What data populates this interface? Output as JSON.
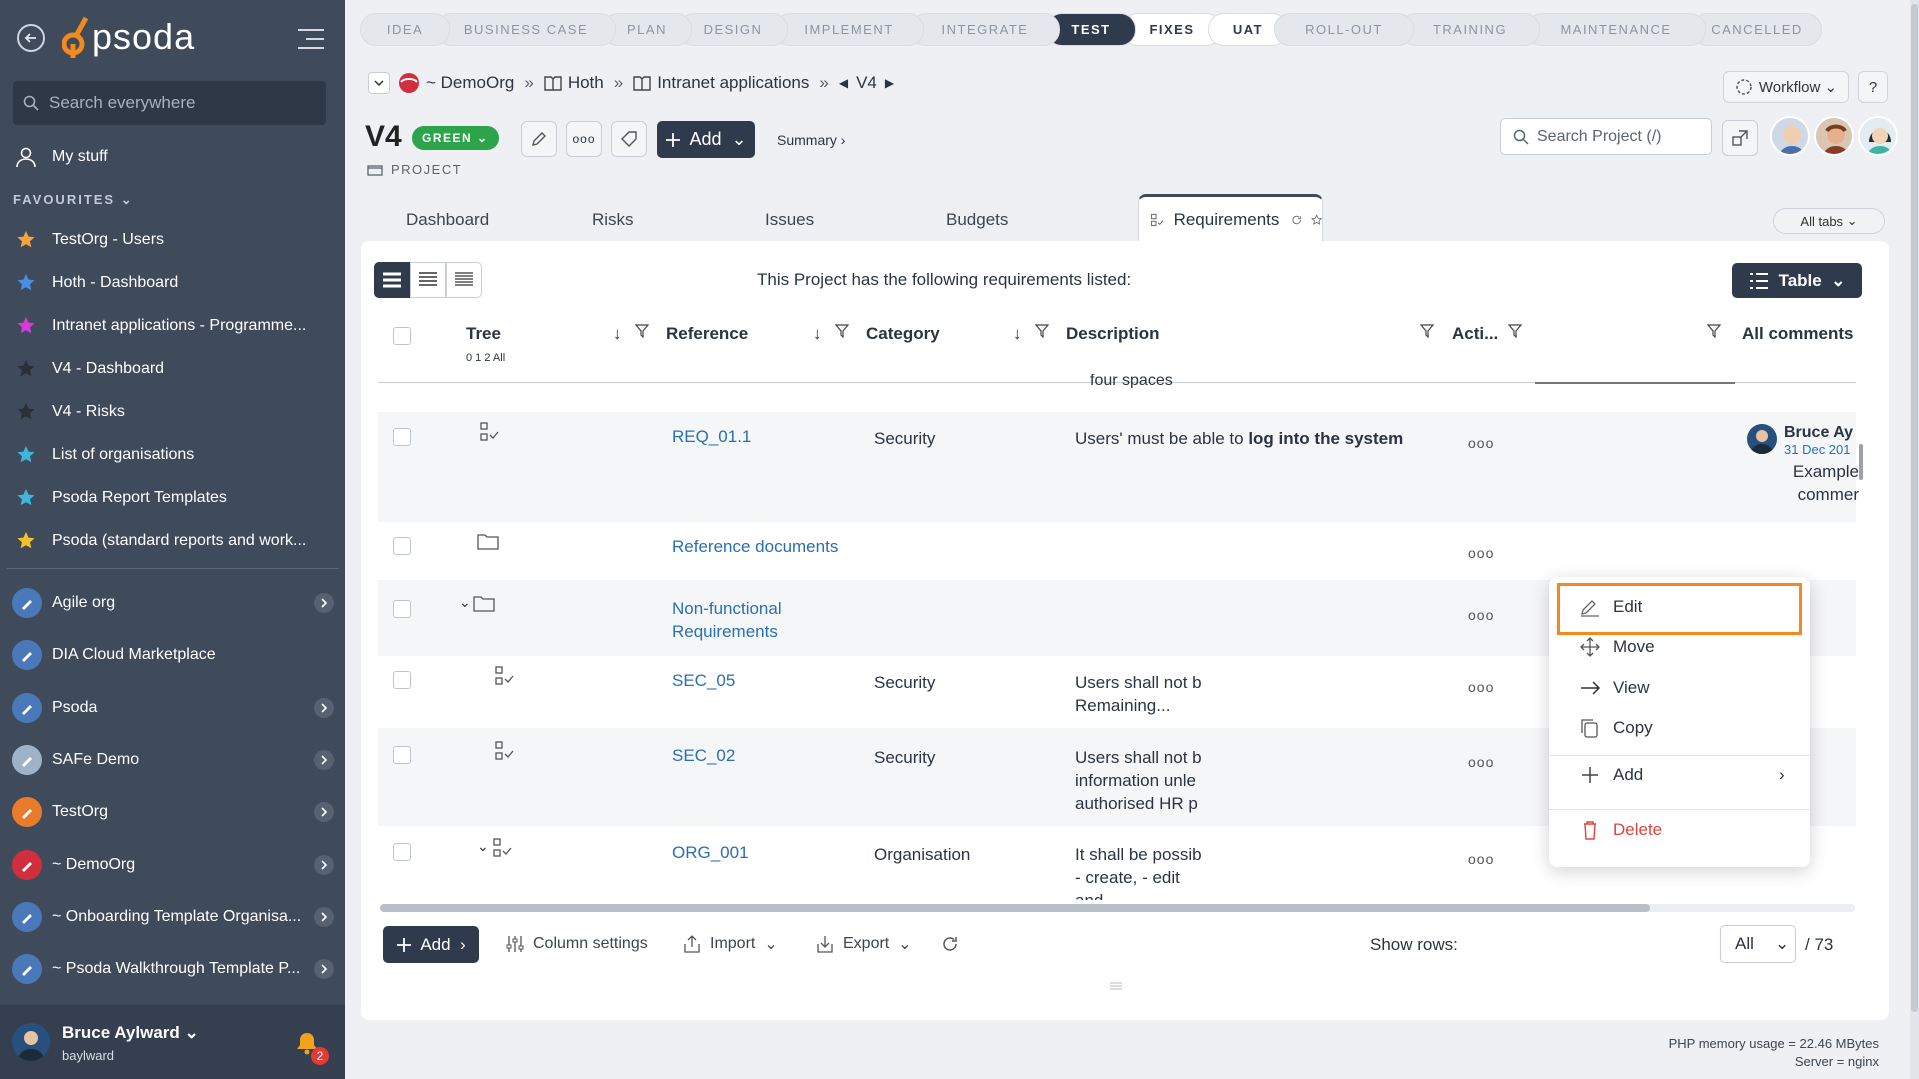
{
  "sidebar": {
    "logo": "psoda",
    "search_placeholder": "Search everywhere",
    "my_stuff": "My stuff",
    "favourites_title": "FAVOURITES",
    "favourites": [
      {
        "label": "TestOrg - Users",
        "color": "#f4a340"
      },
      {
        "label": "Hoth - Dashboard",
        "color": "#4a90e2"
      },
      {
        "label": "Intranet applications - Programme...",
        "color": "#d63ad9"
      },
      {
        "label": "V4 - Dashboard",
        "color": "#2a2f38"
      },
      {
        "label": "V4 - Risks",
        "color": "#2a2f38"
      },
      {
        "label": "List of organisations",
        "color": "#3fb6d8"
      },
      {
        "label": "Psoda Report Templates",
        "color": "#3fb6d8"
      },
      {
        "label": "Psoda (standard reports and work...",
        "color": "#f2c12e"
      }
    ],
    "orgs": [
      {
        "label": "Agile org",
        "color": "#4a78b8",
        "chevron": true
      },
      {
        "label": "DIA Cloud Marketplace",
        "color": "#4a78b8",
        "chevron": false
      },
      {
        "label": "Psoda",
        "color": "#4a78b8",
        "chevron": true
      },
      {
        "label": "SAFe Demo",
        "color": "#9fb3c8",
        "chevron": true
      },
      {
        "label": "TestOrg",
        "color": "#e87b2c",
        "chevron": true
      },
      {
        "label": "~ DemoOrg",
        "color": "#d12f3e",
        "chevron": true
      },
      {
        "label": "~ Onboarding Template Organisa...",
        "color": "#4a78b8",
        "chevron": true
      },
      {
        "label": "~ Psoda Walkthrough Template P...",
        "color": "#4a78b8",
        "chevron": true
      }
    ],
    "user": {
      "name": "Bruce Aylward",
      "login": "baylward",
      "notifications": "2"
    }
  },
  "phases": [
    {
      "label": "IDEA",
      "w": 90,
      "state": ""
    },
    {
      "label": "BUSINESS CASE",
      "w": 180,
      "state": ""
    },
    {
      "label": "PLAN",
      "w": 90,
      "state": ""
    },
    {
      "label": "DESIGN",
      "w": 110,
      "state": ""
    },
    {
      "label": "IMPLEMENT",
      "w": 150,
      "state": ""
    },
    {
      "label": "INTEGRATE",
      "w": 150,
      "state": ""
    },
    {
      "label": "TEST",
      "w": 90,
      "state": "active"
    },
    {
      "label": "FIXES",
      "w": 100,
      "state": "light"
    },
    {
      "label": "UAT",
      "w": 80,
      "state": "light"
    },
    {
      "label": "ROLL-OUT",
      "w": 140,
      "state": ""
    },
    {
      "label": "TRAINING",
      "w": 140,
      "state": ""
    },
    {
      "label": "MAINTENANCE",
      "w": 180,
      "state": ""
    },
    {
      "label": "CANCELLED",
      "w": 130,
      "state": ""
    }
  ],
  "breadcrumb": {
    "org": "~ DemoOrg",
    "programme": "Hoth",
    "project_parent": "Intranet applications",
    "current": "V4"
  },
  "header": {
    "workflow": "Workflow",
    "help": "?",
    "title": "V4",
    "status": "GREEN",
    "type_label": "PROJECT",
    "add_label": "Add",
    "summary": "Summary ›",
    "search_placeholder": "Search Project (/)"
  },
  "tabs": {
    "items": [
      "Dashboard",
      "Risks",
      "Issues",
      "Budgets"
    ],
    "active": "Requirements",
    "all_tabs": "All tabs"
  },
  "table": {
    "intro": "This Project has the following requirements listed:",
    "view_label": "Table",
    "columns": {
      "tree": "Tree",
      "tree_levels": "0 1 2 All",
      "reference": "Reference",
      "category": "Category",
      "description": "Description",
      "actions": "Acti...",
      "comments": "All comments"
    },
    "partial_text": "four spaces",
    "rows": [
      {
        "ref": "REQ_01.1",
        "category": "Security",
        "desc_plain": "Users' must be able to ",
        "desc_bold": "log into the system",
        "comment_author": "Bruce Ay",
        "comment_date": "31 Dec 201",
        "comment_text": "Example commer"
      },
      {
        "ref": "Reference documents"
      },
      {
        "ref": "Non-functional Requirements"
      },
      {
        "ref": "SEC_05",
        "category": "Security",
        "desc": "Users shall not b Remaining..."
      },
      {
        "ref": "SEC_02",
        "category": "Security",
        "desc": "Users shall not b information unle authorised HR p"
      },
      {
        "ref": "ORG_001",
        "category": "Organisation",
        "desc": "It shall be possib - create, - edit and"
      }
    ]
  },
  "context_menu": {
    "edit": "Edit",
    "move": "Move",
    "view": "View",
    "copy": "Copy",
    "add": "Add",
    "delete": "Delete"
  },
  "footer": {
    "add": "Add",
    "column_settings": "Column settings",
    "import": "Import",
    "export": "Export",
    "show_rows": "Show rows:",
    "rows_value": "All",
    "rows_total": "/ 73"
  },
  "memory": {
    "line1": "PHP memory usage = 22.46 MBytes",
    "line2": "Server = nginx"
  }
}
